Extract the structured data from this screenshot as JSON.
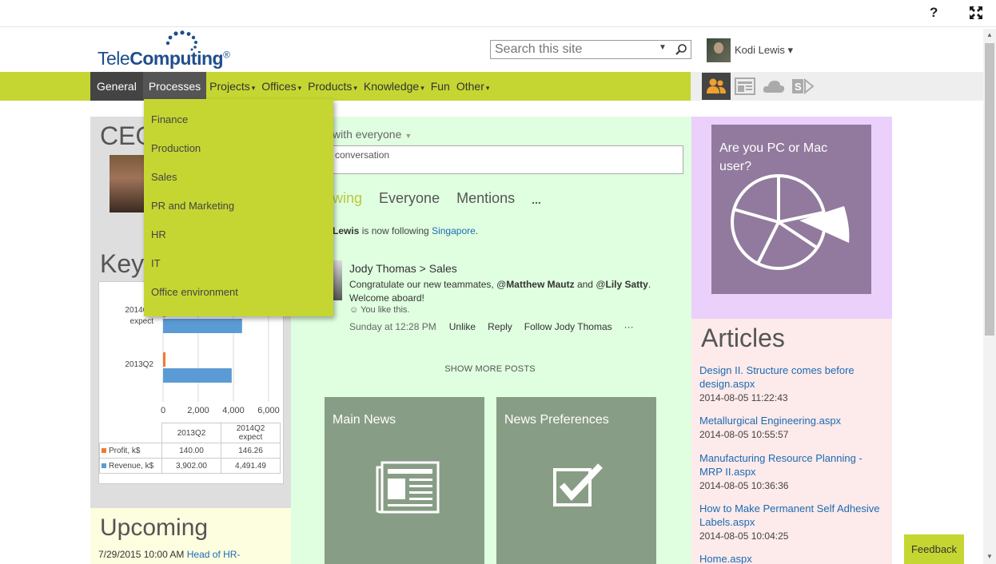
{
  "chrome": {
    "help_label": "?",
    "fullscreen_icon": "expand-icon"
  },
  "logo": {
    "part1": "Tele",
    "part2": "Computing",
    "mark": "®"
  },
  "search": {
    "placeholder": "Search this site"
  },
  "user": {
    "name": "Kodi Lewis",
    "caret": "▾"
  },
  "nav": {
    "items": [
      {
        "label": "General",
        "caret": ""
      },
      {
        "label": "Processes",
        "caret": ""
      },
      {
        "label": "Projects",
        "caret": "▾"
      },
      {
        "label": "Offices",
        "caret": "▾"
      },
      {
        "label": "Products",
        "caret": "▾"
      },
      {
        "label": "Knowledge",
        "caret": "▾"
      },
      {
        "label": "Fun",
        "caret": ""
      },
      {
        "label": "Other",
        "caret": "▾"
      }
    ]
  },
  "suite_icons": [
    "people-icon",
    "newsfeed-icon",
    "onedrive-icon",
    "sharepoint-sites-icon"
  ],
  "dropdown": {
    "items": [
      "Finance",
      "Production",
      "Sales",
      "PR and Marketing",
      "HR",
      "IT",
      "Office environment"
    ]
  },
  "left": {
    "ceo_title": "CEO",
    "key_title": "Key"
  },
  "chart_data": {
    "type": "bar",
    "orientation": "horizontal",
    "categories": [
      "2014Q2 expect",
      "2013Q2"
    ],
    "series": [
      {
        "name": "Profit, k$",
        "values": [
          146.26,
          140.0
        ],
        "color": "#ed7d31"
      },
      {
        "name": "Revenue, k$",
        "values": [
          4491.49,
          3902.0
        ],
        "color": "#5b9bd5"
      }
    ],
    "xlim": [
      0,
      6000
    ],
    "x_ticks": [
      "0",
      "2,000",
      "4,000",
      "6,000"
    ],
    "table": {
      "headers": [
        "2013Q2",
        "2014Q2 expect"
      ],
      "rows": [
        {
          "name": "Profit, k$",
          "values": [
            "140.00",
            "146.26"
          ]
        },
        {
          "name": "Revenue, k$",
          "values": [
            "3,902.00",
            "4,491.49"
          ]
        }
      ]
    },
    "grid": true,
    "legend": "table-bottom"
  },
  "upcoming": {
    "title": "Upcoming",
    "date": "7/29/2015 10:00 AM",
    "link": "Head of HR-"
  },
  "feed": {
    "share_label": "with everyone",
    "convo_placeholder": "conversation",
    "tabs": [
      "wing",
      "Everyone",
      "Mentions",
      "..."
    ],
    "follow": {
      "who": "Lewis",
      "text": " is now following ",
      "target": "Singapore",
      "end": "."
    },
    "post": {
      "author": "Jody Thomas > Sales",
      "body_prefix": "Congratulate our new teammates, @",
      "mention1": "Matthew Mautz",
      "body_mid": " and @",
      "mention2": "Lily Satty",
      "body_suffix": ". Welcome aboard!",
      "likes": "You like this.",
      "timestamp": "Sunday at 12:28 PM",
      "actions": [
        "Unlike",
        "Reply",
        "Follow Jody Thomas",
        "···"
      ]
    },
    "show_more": "SHOW MORE POSTS"
  },
  "tiles": [
    {
      "title": "Main News",
      "icon": "newspaper-icon"
    },
    {
      "title": "News Preferences",
      "icon": "checkbox-icon"
    }
  ],
  "poll": {
    "title": "Are you PC or Mac user?",
    "icon": "pie-chart-icon"
  },
  "articles": {
    "title": "Articles",
    "items": [
      {
        "title": "Design II. Structure comes before design.aspx",
        "date": "2014-08-05 11:22:43"
      },
      {
        "title": "Metallurgical Engineering.aspx",
        "date": "2014-08-05 10:55:57"
      },
      {
        "title": "Manufacturing Resource Planning - MRP II.aspx",
        "date": "2014-08-05 10:36:36"
      },
      {
        "title": "How to Make Permanent Self Adhesive Labels.aspx",
        "date": "2014-08-05 10:04:25"
      },
      {
        "title": "Home.aspx",
        "date": ""
      }
    ]
  },
  "feedback": {
    "label": "Feedback"
  },
  "colors": {
    "accent": "#c5d632",
    "feed_bg": "#e0ffe0",
    "poll_bg": "#ead0fb",
    "articles_bg": "#fdeaea",
    "upcoming_bg": "#fdfddf",
    "tile": "#889d85",
    "poll_tile": "#917a9e"
  }
}
